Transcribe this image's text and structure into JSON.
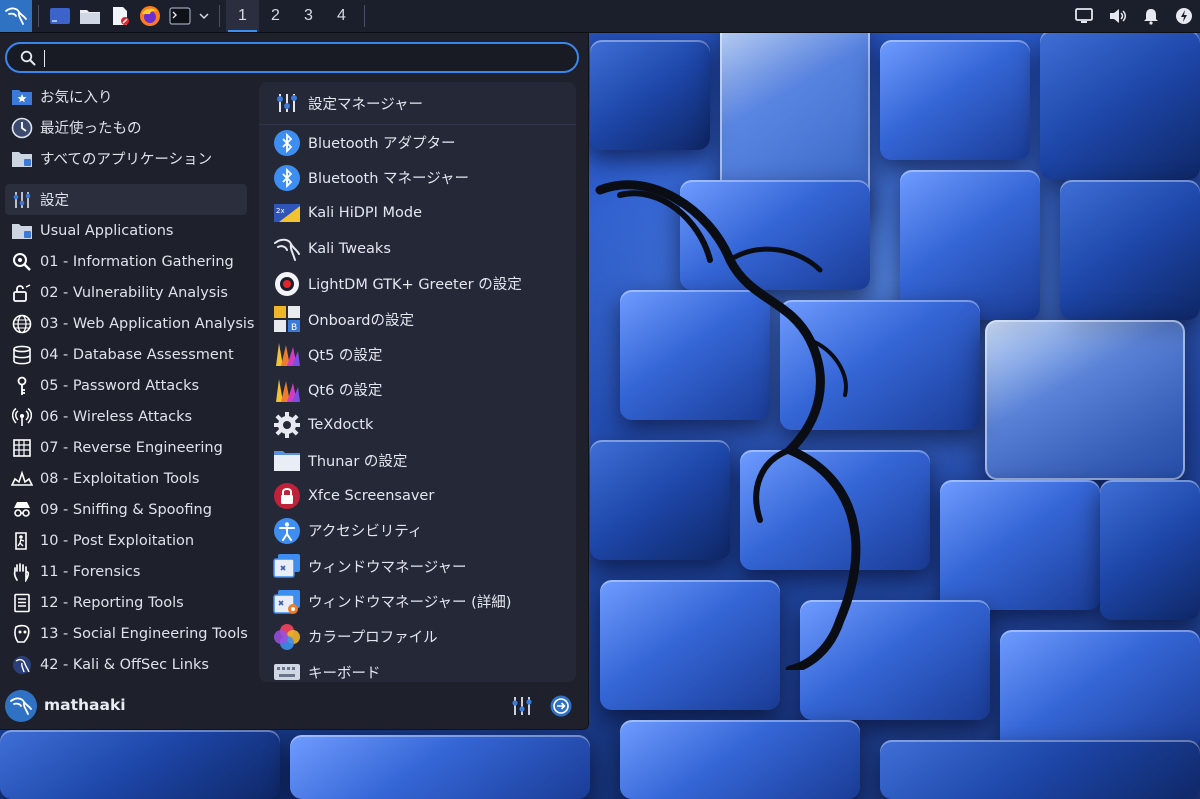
{
  "colors": {
    "accent": "#3a86ee",
    "panel_bg": "#1b1e2b",
    "menu_bg": "#1e202c",
    "apps_bg": "#252837"
  },
  "panel": {
    "launchers": [
      {
        "icon": "kali-menu-icon"
      },
      {
        "icon": "show-desktop-icon"
      },
      {
        "icon": "file-manager-icon"
      },
      {
        "icon": "text-editor-icon"
      },
      {
        "icon": "firefox-icon"
      },
      {
        "icon": "terminal-icon"
      }
    ],
    "workspaces": [
      "1",
      "2",
      "3",
      "4"
    ],
    "active_workspace": "1",
    "tray": [
      "display-icon",
      "volume-icon",
      "notification-bell-icon",
      "power-icon"
    ]
  },
  "menu": {
    "search": {
      "value": "",
      "placeholder": ""
    },
    "favorites": [
      {
        "label": "お気に入り",
        "icon": "favorites-folder-icon"
      },
      {
        "label": "最近使ったもの",
        "icon": "recent-clock-icon"
      },
      {
        "label": "すべてのアプリケーション",
        "icon": "all-apps-icon"
      }
    ],
    "categories": [
      {
        "label": "設定",
        "icon": "settings-sliders-icon",
        "selected": true
      },
      {
        "label": "Usual Applications",
        "icon": "usual-apps-icon"
      },
      {
        "label": "01 - Information Gathering",
        "icon": "magnifier-icon"
      },
      {
        "label": "02 - Vulnerability Analysis",
        "icon": "vulnerability-icon"
      },
      {
        "label": "03 - Web Application Analysis",
        "icon": "globe-icon"
      },
      {
        "label": "04 - Database Assessment",
        "icon": "database-icon"
      },
      {
        "label": "05 - Password Attacks",
        "icon": "key-icon"
      },
      {
        "label": "06 - Wireless Attacks",
        "icon": "wireless-icon"
      },
      {
        "label": "07 - Reverse Engineering",
        "icon": "reverse-engineering-icon"
      },
      {
        "label": "08 - Exploitation Tools",
        "icon": "exploitation-icon"
      },
      {
        "label": "09 - Sniffing & Spoofing",
        "icon": "spy-icon"
      },
      {
        "label": "10 - Post Exploitation",
        "icon": "post-exploitation-icon"
      },
      {
        "label": "11 - Forensics",
        "icon": "hand-icon"
      },
      {
        "label": "12 - Reporting Tools",
        "icon": "report-icon"
      },
      {
        "label": "13 - Social Engineering Tools",
        "icon": "social-engineering-icon"
      },
      {
        "label": "42 - Kali & OffSec Links",
        "icon": "kali-links-icon"
      }
    ],
    "apps_header": {
      "label": "設定マネージャー",
      "icon": "settings-manager-icon"
    },
    "apps": [
      {
        "label": "Bluetooth アダプター",
        "icon": "bluetooth-icon"
      },
      {
        "label": "Bluetooth マネージャー",
        "icon": "bluetooth-icon"
      },
      {
        "label": "Kali HiDPI Mode",
        "icon": "hidpi-icon"
      },
      {
        "label": "Kali Tweaks",
        "icon": "kali-tweaks-icon"
      },
      {
        "label": "LightDM GTK+ Greeter の設定",
        "icon": "lightdm-icon"
      },
      {
        "label": "Onboardの設定",
        "icon": "onboard-icon"
      },
      {
        "label": "Qt5 の設定",
        "icon": "qt-icon"
      },
      {
        "label": "Qt6 の設定",
        "icon": "qt-icon"
      },
      {
        "label": "TeXdoctk",
        "icon": "gear-icon"
      },
      {
        "label": "Thunar の設定",
        "icon": "folder-icon"
      },
      {
        "label": "Xfce Screensaver",
        "icon": "lock-icon"
      },
      {
        "label": "アクセシビリティ",
        "icon": "accessibility-icon"
      },
      {
        "label": "ウィンドウマネージャー",
        "icon": "window-manager-icon"
      },
      {
        "label": "ウィンドウマネージャー (詳細)",
        "icon": "window-manager-tweaks-icon"
      },
      {
        "label": "カラープロファイル",
        "icon": "color-profile-icon"
      },
      {
        "label": "キーボード",
        "icon": "keyboard-icon"
      }
    ],
    "footer": {
      "username": "mathaaki",
      "buttons": [
        "settings-sliders-icon",
        "logout-icon"
      ]
    }
  }
}
